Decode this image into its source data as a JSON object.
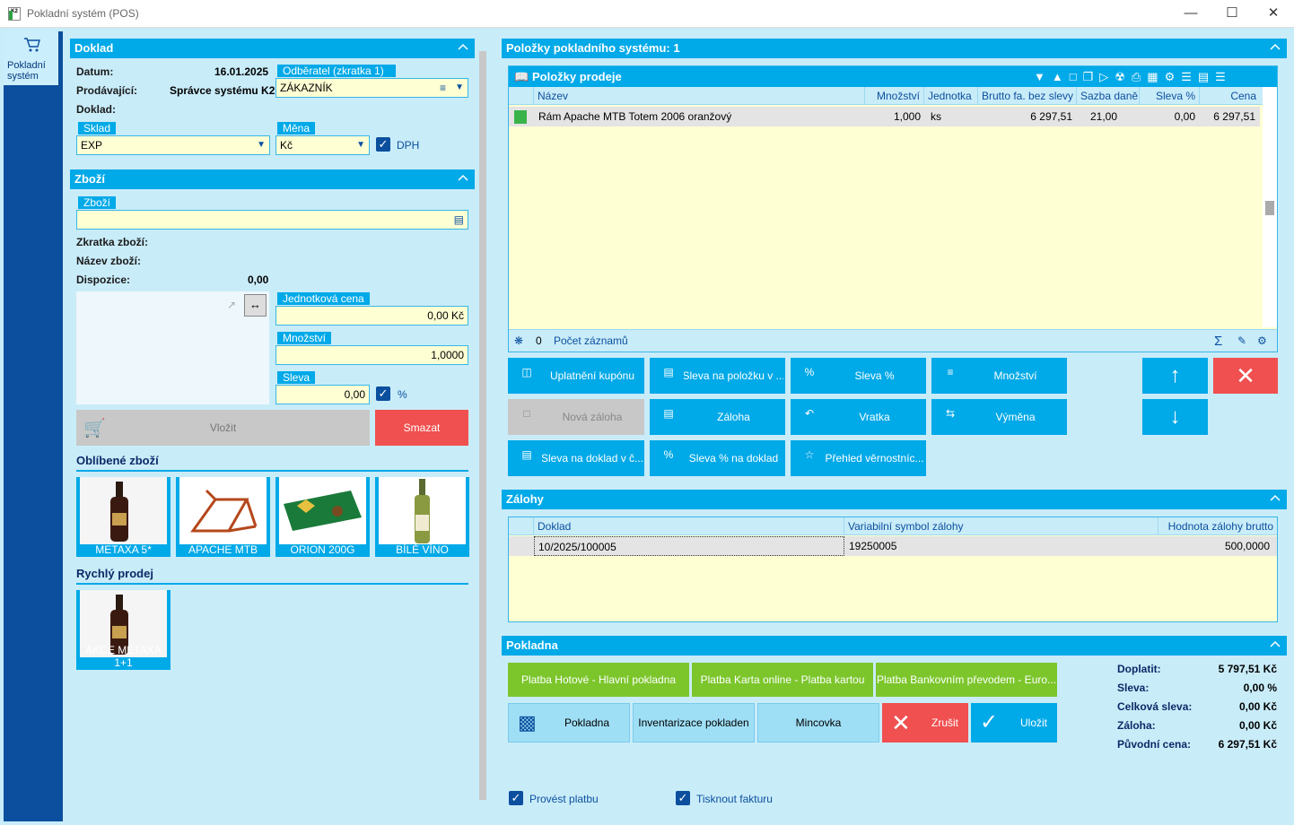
{
  "window": {
    "title": "Pokladní systém (POS)",
    "logo": "K2"
  },
  "nav": {
    "item_label": "Pokladní systém",
    "icon": "cart-icon"
  },
  "doklad": {
    "header": "Doklad",
    "datum_label": "Datum:",
    "datum": "16.01.2025",
    "prodavajici_label": "Prodávající:",
    "prodavajici": "Správce systému K2",
    "doklad_label": "Doklad:",
    "odberatel_tab": "Odběratel (zkratka 1)",
    "odberatel": "ZÁKAZNÍK",
    "sklad_tab": "Sklad",
    "sklad": "EXP",
    "mena_tab": "Měna",
    "mena": "Kč",
    "dph_label": "DPH"
  },
  "zbozi": {
    "header": "Zboží",
    "zbozi_tab": "Zboží",
    "zbozi_value": "",
    "zkratka_label": "Zkratka zboží:",
    "nazev_label": "Název zboží:",
    "dispozice_label": "Dispozice:",
    "dispozice": "0,00",
    "jedn_cena_tab": "Jednotková cena",
    "jedn_cena": "0,00 Kč",
    "mnozstvi_tab": "Množství",
    "mnozstvi": "1,0000",
    "sleva_tab": "Sleva",
    "sleva": "0,00",
    "sleva_pct": "%",
    "vlozit": "Vložit",
    "smazat": "Smazat",
    "oblibene_label": "Oblíbené zboží",
    "oblibene": [
      "METAXA 5*",
      "APACHE MTB",
      "ORION 200G",
      "BÍLÉ VÍNO"
    ],
    "rychly_label": "Rychlý prodej",
    "rychly": [
      "AKCE METAXA 1+1"
    ]
  },
  "polozky": {
    "header": "Položky pokladního systému: 1",
    "grid_title": "Položky prodeje",
    "columns": [
      "Název",
      "Množství",
      "Jednotka",
      "Brutto fa. bez slevy",
      "Sazba daně",
      "Sleva %",
      "Cena"
    ],
    "rows": [
      [
        "Rám Apache MTB Totem 2006 oranžový",
        "1,000",
        "ks",
        "6 297,51",
        "21,00",
        "0,00",
        "6 297,51"
      ]
    ],
    "footer_count": "0",
    "footer_label": "Počet záznamů"
  },
  "actions": {
    "kupon": "Uplatnění kupónu",
    "sleva_polozka": "Sleva na položku v ...",
    "sleva_pct": "Sleva %",
    "mnozstvi": "Množství",
    "nova_zaloha": "Nová záloha",
    "zaloha": "Záloha",
    "vratka": "Vratka",
    "vymena": "Výměna",
    "sleva_doklad": "Sleva na doklad v č...",
    "sleva_pct_doklad": "Sleva % na doklad",
    "vernost": "Přehled věrnostníc..."
  },
  "zalohy": {
    "header": "Zálohy",
    "columns": [
      "Doklad",
      "Variabilní symbol zálohy",
      "Hodnota zálohy brutto"
    ],
    "rows": [
      [
        "10/2025/100005",
        "19250005",
        "500,0000"
      ]
    ]
  },
  "pokladna": {
    "header": "Pokladna",
    "pay1": "Platba Hotové - Hlavní pokladna",
    "pay2": "Platba Karta online - Platba kartou",
    "pay3": "Platba Bankovním převodem - Euro...",
    "pokladna": "Pokladna",
    "inventarizace": "Inventarizace pokladen",
    "mincovka": "Mincovka",
    "zrusit": "Zrušit",
    "ulozit": "Uložit",
    "sum": [
      {
        "label": "Doplatit:",
        "value": "5 797,51 Kč"
      },
      {
        "label": "Sleva:",
        "value": "0,00 %"
      },
      {
        "label": "Celková sleva:",
        "value": "0,00 Kč"
      },
      {
        "label": "Záloha:",
        "value": "0,00 Kč"
      },
      {
        "label": "Původní cena:",
        "value": "6 297,51 Kč"
      }
    ],
    "provest": "Provést platbu",
    "tisknout": "Tisknout fakturu"
  },
  "colors": {
    "accent": "#00a9e8",
    "nav": "#0b4f9e",
    "input": "#ffffd4",
    "green": "#7cc62c",
    "red": "#f05050"
  }
}
